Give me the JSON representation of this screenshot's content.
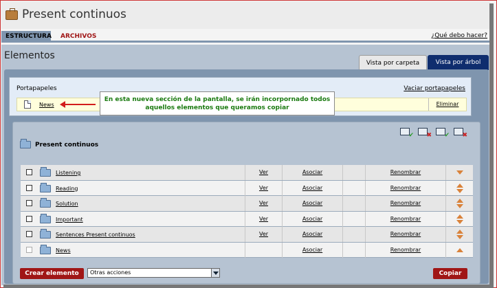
{
  "app": {
    "title": "Present continuos"
  },
  "tabs": {
    "structure": "ESTRUCTURA",
    "files": "ARCHIVOS",
    "help": "¿Qué debo hacer?"
  },
  "section": {
    "title": "Elementos",
    "view_folder": "Vista por carpeta",
    "view_tree": "Vista por árbol"
  },
  "clipboard": {
    "label": "Portapapeles",
    "empty_link": "Vaciar portapapeles",
    "item_name": "News",
    "delete": "Eliminar"
  },
  "callout": {
    "line1": "En esta nueva sección de la pantalla, se irán incorpornado todos",
    "line2": "aquellos elementos que queramos copiar"
  },
  "list": {
    "folder_title": "Present continuos",
    "rows": [
      {
        "name": "Listening",
        "ver": "Ver",
        "asociar": "Asociar",
        "renombrar": "Renombrar"
      },
      {
        "name": "Reading",
        "ver": "Ver",
        "asociar": "Asociar",
        "renombrar": "Renombrar"
      },
      {
        "name": "Solution",
        "ver": "Ver",
        "asociar": "Asociar",
        "renombrar": "Renombrar"
      },
      {
        "name": "Important",
        "ver": "Ver",
        "asociar": "Asociar",
        "renombrar": "Renombrar"
      },
      {
        "name": "Sentences Present continuos",
        "ver": "Ver",
        "asociar": "Asociar",
        "renombrar": "Renombrar"
      },
      {
        "name": "News",
        "ver": "",
        "asociar": "Asociar",
        "renombrar": "Renombrar"
      }
    ]
  },
  "footer": {
    "create": "Crear elemento",
    "actions": "Otras acciones",
    "copy": "Copiar"
  },
  "icons": {
    "title": "briefcase-icon",
    "folder": "folder-icon",
    "document": "document-icon",
    "order_up": "arrow-up-icon",
    "order_down": "arrow-down-icon",
    "toolbar": [
      "add-folder-icon",
      "delete-folder-icon",
      "add-item-icon",
      "delete-item-icon"
    ]
  },
  "colors": {
    "accent_red": "#a01616",
    "panel_blue": "#7f95ae",
    "tree_tab": "#0f2d6e",
    "callout_text": "#1a7a10",
    "arrow": "#d21c1c"
  }
}
